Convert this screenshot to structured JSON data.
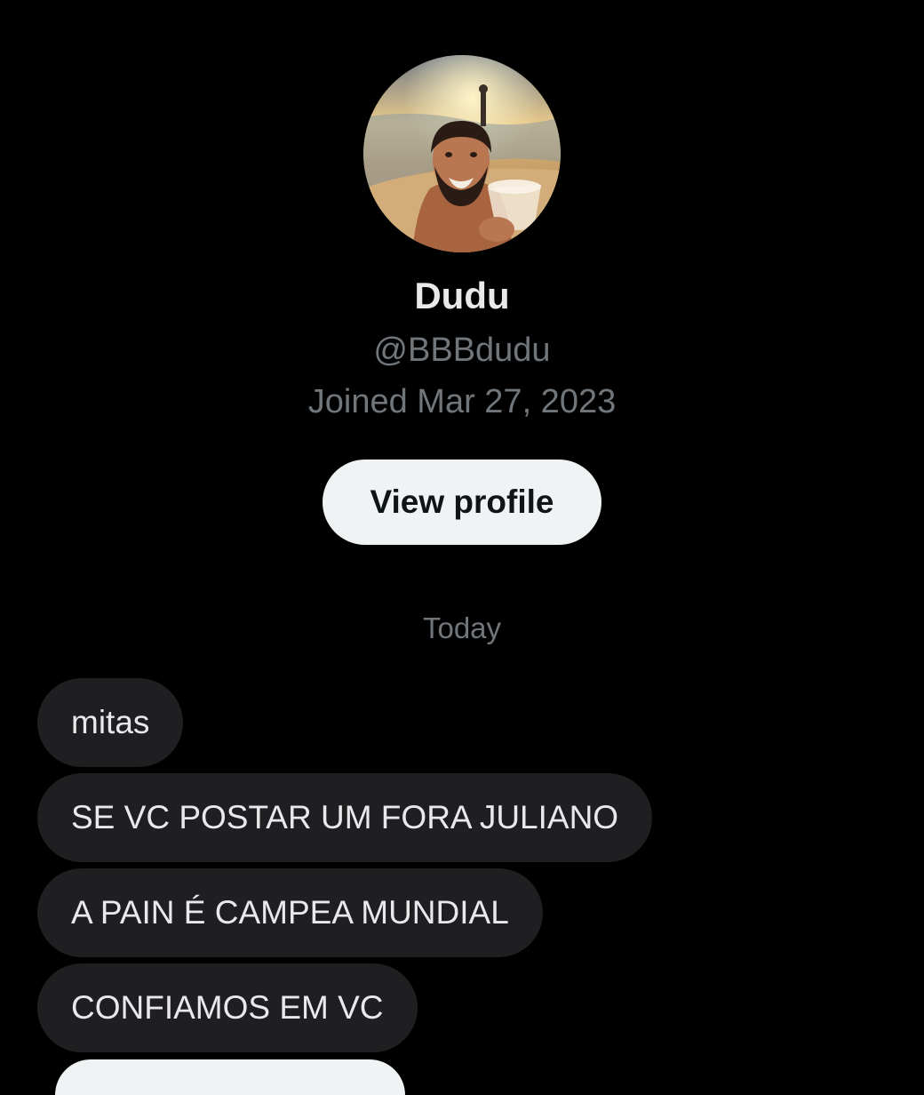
{
  "profile": {
    "display_name": "Dudu",
    "handle": "@BBBdudu",
    "joined": "Joined Mar 27, 2023",
    "view_profile_label": "View profile",
    "avatar_icon": "profile-photo"
  },
  "conversation": {
    "date_separator": "Today",
    "messages": [
      {
        "text": "mitas"
      },
      {
        "text": "SE VC POSTAR UM FORA JULIANO"
      },
      {
        "text": "A PAIN É CAMPEA MUNDIAL"
      },
      {
        "text": "CONFIAMOS EM VC"
      }
    ]
  },
  "colors": {
    "background": "#000000",
    "primary_text": "#e7e9ea",
    "secondary_text": "#71767b",
    "bubble_received": "#1f1f22",
    "button_background": "#eff3f4",
    "button_text": "#0f1419"
  }
}
